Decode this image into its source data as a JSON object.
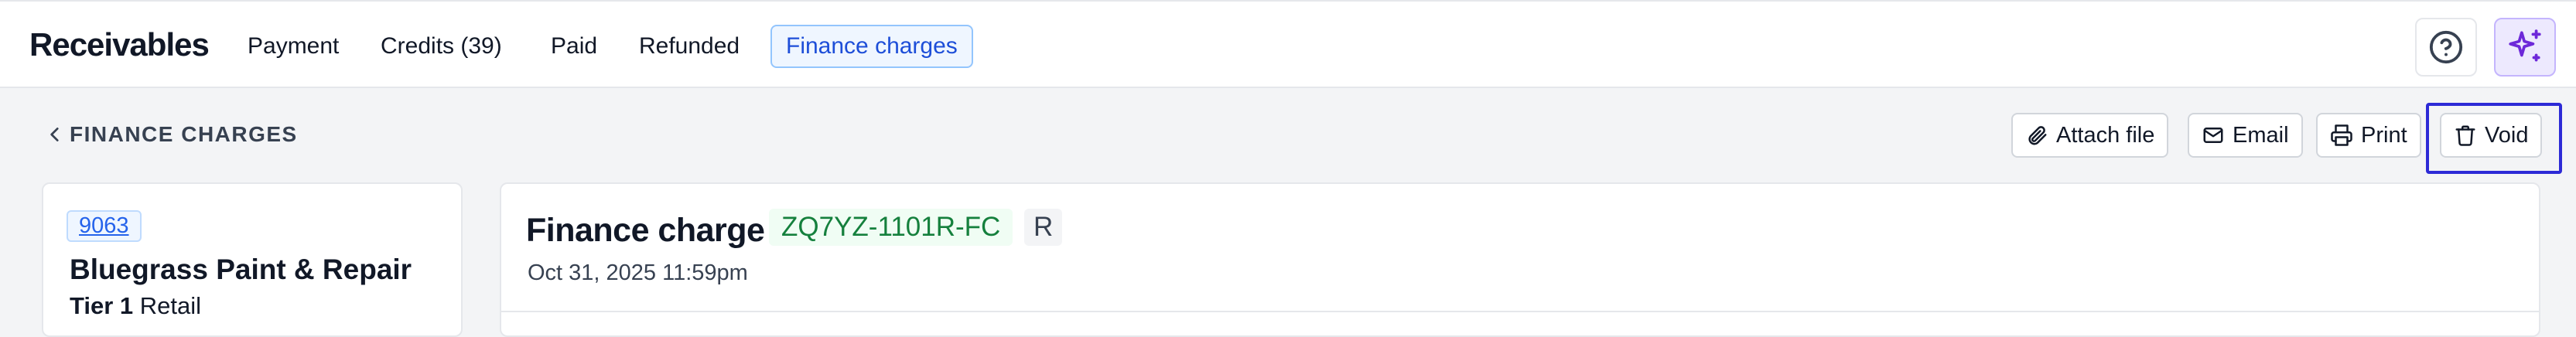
{
  "app": {
    "title": "Receivables"
  },
  "nav": {
    "tabs": [
      {
        "label": "Payment"
      },
      {
        "label": "Credits (39)"
      },
      {
        "label": "Paid"
      },
      {
        "label": "Refunded"
      },
      {
        "label": "Finance charges",
        "active": true
      }
    ]
  },
  "header_icons": {
    "help": "help-circle-icon",
    "assistant": "sparkles-icon"
  },
  "breadcrumb": {
    "back_label": "FINANCE CHARGES",
    "icon": "chevron-left-icon"
  },
  "actions": [
    {
      "label": "Attach file",
      "icon": "paperclip-icon"
    },
    {
      "label": "Email",
      "icon": "mail-icon"
    },
    {
      "label": "Print",
      "icon": "printer-icon"
    },
    {
      "label": "Void",
      "icon": "trash-icon",
      "highlighted": true
    }
  ],
  "customer": {
    "account_number": "9063",
    "name": "Bluegrass Paint & Repair",
    "tier": "Tier 1",
    "type": "Retail"
  },
  "document": {
    "title": "Finance charge",
    "code": "ZQ7YZ-1101R-FC",
    "badge": "R",
    "date": "Oct 31, 2025 11:59pm"
  },
  "colors": {
    "accent": "#2563eb",
    "highlight_border": "#2d2ad6",
    "code_green": "#15803d",
    "assistant_bg": "#ede9fe"
  }
}
